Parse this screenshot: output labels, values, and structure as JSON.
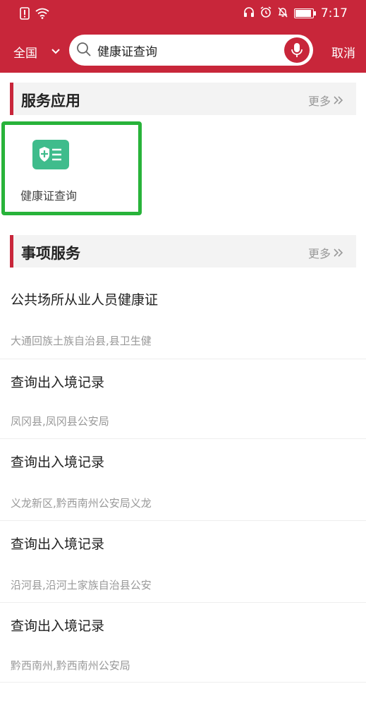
{
  "status_bar": {
    "time": "7:17"
  },
  "search": {
    "region": "全国",
    "query": "健康证查询",
    "cancel_label": "取消"
  },
  "sections": {
    "service_apps": {
      "title": "服务应用",
      "more_label": "更多"
    },
    "matters": {
      "title": "事项服务",
      "more_label": "更多"
    }
  },
  "apps": [
    {
      "label": "健康证查询",
      "icon": "health-card-icon",
      "color": "#3fbc8c"
    }
  ],
  "items": [
    {
      "title": "公共场所从业人员健康证",
      "subtitle": "大通回族土族自治县,县卫生健"
    },
    {
      "title": "查询出入境记录",
      "subtitle": "凤冈县,凤冈县公安局"
    },
    {
      "title": "查询出入境记录",
      "subtitle": "义龙新区,黔西南州公安局义龙"
    },
    {
      "title": "查询出入境记录",
      "subtitle": "沿河县,沿河土家族自治县公安"
    },
    {
      "title": "查询出入境记录",
      "subtitle": "黔西南州,黔西南州公安局"
    }
  ],
  "colors": {
    "brand": "#c8263a",
    "highlight": "#28b33a",
    "app_icon": "#3fbc8c"
  }
}
